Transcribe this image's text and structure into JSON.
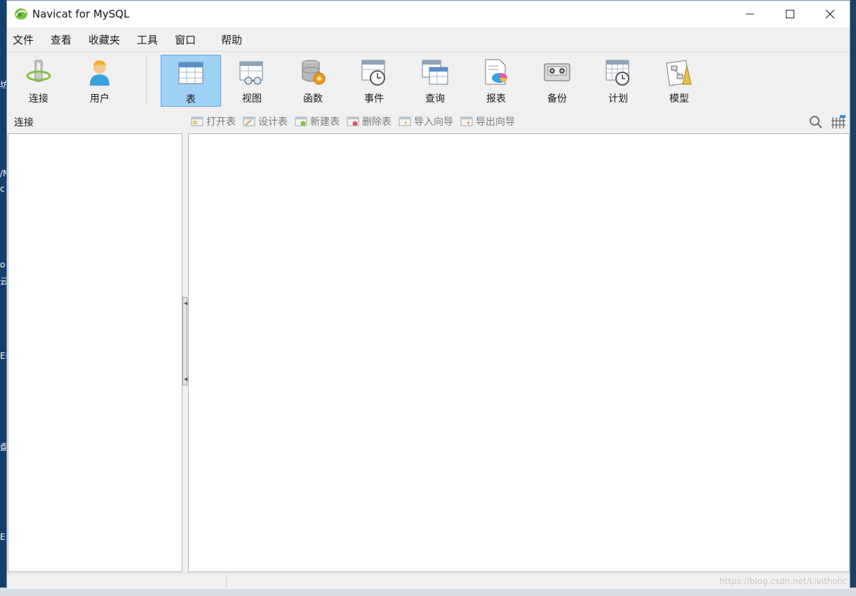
{
  "window": {
    "title": "Navicat for MySQL"
  },
  "menu": [
    "文件",
    "查看",
    "收藏夹",
    "工具",
    "窗口",
    "帮助"
  ],
  "toolbar": {
    "left": [
      {
        "label": "连接",
        "icon": "connection-icon"
      },
      {
        "label": "用户",
        "icon": "user-icon"
      }
    ],
    "main": [
      {
        "label": "表",
        "icon": "table-icon",
        "active": true
      },
      {
        "label": "视图",
        "icon": "view-icon"
      },
      {
        "label": "函数",
        "icon": "function-icon"
      },
      {
        "label": "事件",
        "icon": "event-icon"
      },
      {
        "label": "查询",
        "icon": "query-icon"
      },
      {
        "label": "报表",
        "icon": "report-icon"
      },
      {
        "label": "备份",
        "icon": "backup-icon"
      },
      {
        "label": "计划",
        "icon": "schedule-icon"
      },
      {
        "label": "模型",
        "icon": "model-icon"
      }
    ]
  },
  "subbar": {
    "connection_header": "连接",
    "actions": [
      "打开表",
      "设计表",
      "新建表",
      "删除表",
      "导入向导",
      "导出向导"
    ]
  },
  "watermark": "https://blog.csdn.net/Livitholic",
  "desktop_fragments": [
    "坊",
    "/N",
    "c",
    "o",
    "云",
    "ER",
    "盘",
    "E"
  ]
}
